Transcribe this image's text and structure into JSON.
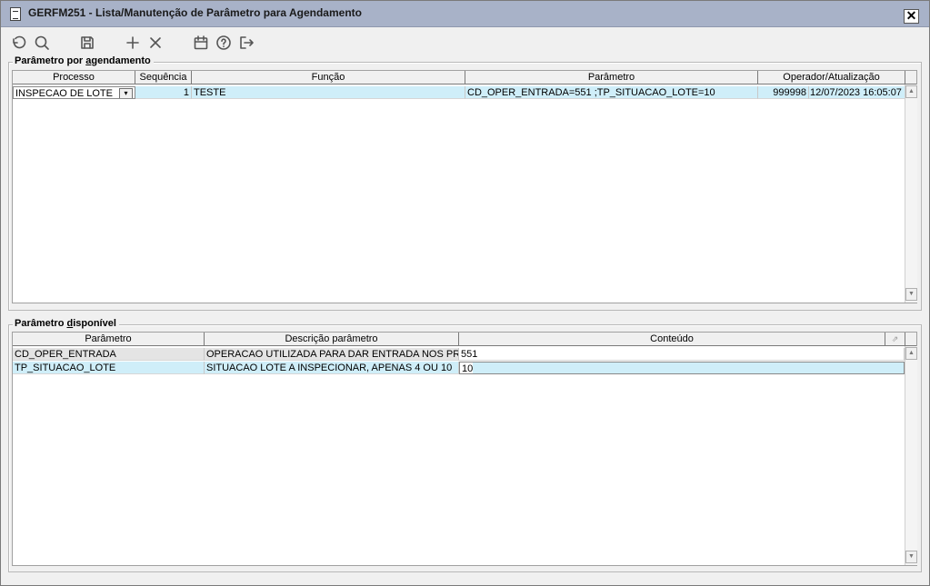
{
  "window": {
    "title": "GERFM251 - Lista/Manutenção de Parâmetro para Agendamento",
    "close_label": "✕"
  },
  "toolbar": {
    "icons": [
      "undo-icon",
      "search-icon",
      "save-icon",
      "add-icon",
      "delete-icon",
      "calendar-icon",
      "help-icon",
      "exit-icon"
    ]
  },
  "agendamento": {
    "legend_pre": "Parâmetro por ",
    "legend_key": "a",
    "legend_post": "gendamento",
    "columns": [
      "Processo",
      "Sequência",
      "Função",
      "Parâmetro",
      "Operador/Atualização"
    ],
    "rows": [
      {
        "processo": "INSPECAO DE LOTE",
        "sequencia": "1",
        "funcao": "TESTE",
        "parametro": "CD_OPER_ENTRADA=551 ;TP_SITUACAO_LOTE=10",
        "operador": "999998",
        "atualizacao": "12/07/2023 16:05:07"
      }
    ]
  },
  "disponivel": {
    "legend_pre": "Parâmetro ",
    "legend_key": "d",
    "legend_post": "isponível",
    "columns": [
      "Parâmetro",
      "Descrição parâmetro",
      "Conteúdo"
    ],
    "rows": [
      {
        "parametro": "CD_OPER_ENTRADA",
        "descricao": "OPERACAO UTILIZADA PARA DAR ENTRADA NOS PRODUTOS",
        "conteudo": "551"
      },
      {
        "parametro": "TP_SITUACAO_LOTE",
        "descricao": "SITUACAO LOTE A INSPECIONAR, APENAS 4 OU 10",
        "conteudo": "10"
      }
    ]
  },
  "colors": {
    "titlebar": "#a8b2c8",
    "selected_row": "#cfeef9",
    "window_bg": "#f0f0f0"
  }
}
